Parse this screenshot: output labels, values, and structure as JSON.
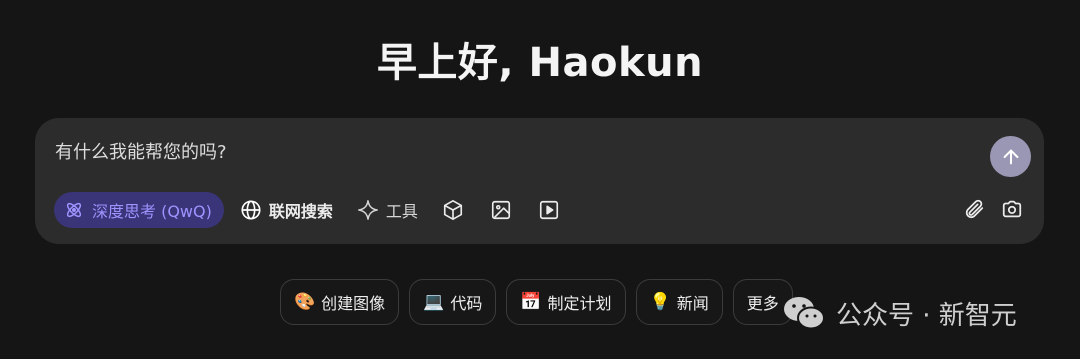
{
  "greeting": "早上好, Haokun",
  "composer": {
    "placeholder": "有什么我能帮您的吗?",
    "tools": {
      "deep_think": "深度思考 (QwQ)",
      "web_search": "联网搜索",
      "tools": "工具"
    },
    "icons": [
      "atom-icon",
      "globe-icon",
      "sparkle-icon",
      "cube-icon",
      "image-icon",
      "video-icon",
      "paperclip-icon",
      "camera-icon",
      "arrow-up-icon"
    ]
  },
  "suggestions": [
    {
      "emoji": "🎨",
      "label": "创建图像"
    },
    {
      "emoji": "💻",
      "label": "代码"
    },
    {
      "emoji": "📅",
      "label": "制定计划"
    },
    {
      "emoji": "💡",
      "label": "新闻"
    },
    {
      "emoji": "",
      "label": "更多"
    }
  ],
  "watermark": {
    "text": "公众号 · 新智元"
  },
  "colors": {
    "background": "#151515",
    "composer": "#2c2c2c",
    "accent": "#9d94ff",
    "chip": "#3a3479",
    "send": "#9a97b4"
  }
}
